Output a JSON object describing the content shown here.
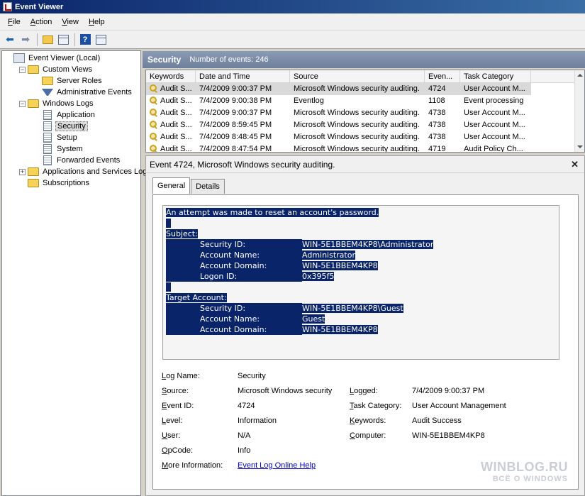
{
  "window": {
    "title": "Event Viewer"
  },
  "menu": [
    "File",
    "Action",
    "View",
    "Help"
  ],
  "tree": [
    {
      "label": "Event Viewer (Local)",
      "level": 0,
      "icon": "computer",
      "expander": ""
    },
    {
      "label": "Custom Views",
      "level": 1,
      "icon": "folder",
      "expander": "−"
    },
    {
      "label": "Server Roles",
      "level": 2,
      "icon": "folder",
      "expander": ""
    },
    {
      "label": "Administrative Events",
      "level": 2,
      "icon": "filter",
      "expander": ""
    },
    {
      "label": "Windows Logs",
      "level": 1,
      "icon": "folder",
      "expander": "−"
    },
    {
      "label": "Application",
      "level": 2,
      "icon": "log",
      "expander": ""
    },
    {
      "label": "Security",
      "level": 2,
      "icon": "log",
      "expander": "",
      "selected": true
    },
    {
      "label": "Setup",
      "level": 2,
      "icon": "log",
      "expander": ""
    },
    {
      "label": "System",
      "level": 2,
      "icon": "log",
      "expander": ""
    },
    {
      "label": "Forwarded Events",
      "level": 2,
      "icon": "log",
      "expander": ""
    },
    {
      "label": "Applications and Services Logs",
      "level": 1,
      "icon": "folder",
      "expander": "+"
    },
    {
      "label": "Subscriptions",
      "level": 1,
      "icon": "folder",
      "expander": ""
    }
  ],
  "pane": {
    "title": "Security",
    "count": "Number of events: 246"
  },
  "events": {
    "columns": [
      "Keywords",
      "Date and Time",
      "Source",
      "Even...",
      "Task Category"
    ],
    "rows": [
      {
        "keywords": "Audit S...",
        "date": "7/4/2009 9:00:37 PM",
        "source": "Microsoft Windows security auditing.",
        "id": "4724",
        "task": "User Account M...",
        "selected": true
      },
      {
        "keywords": "Audit S...",
        "date": "7/4/2009 9:00:38 PM",
        "source": "Eventlog",
        "id": "1108",
        "task": "Event processing"
      },
      {
        "keywords": "Audit S...",
        "date": "7/4/2009 9:00:37 PM",
        "source": "Microsoft Windows security auditing.",
        "id": "4738",
        "task": "User Account M..."
      },
      {
        "keywords": "Audit S...",
        "date": "7/4/2009 8:59:45 PM",
        "source": "Microsoft Windows security auditing.",
        "id": "4738",
        "task": "User Account M..."
      },
      {
        "keywords": "Audit S...",
        "date": "7/4/2009 8:48:45 PM",
        "source": "Microsoft Windows security auditing.",
        "id": "4738",
        "task": "User Account M..."
      },
      {
        "keywords": "Audit S...",
        "date": "7/4/2009 8:47:54 PM",
        "source": "Microsoft Windows security auditing.",
        "id": "4719",
        "task": "Audit Policy Ch..."
      }
    ]
  },
  "detail": {
    "header": "Event 4724, Microsoft Windows security auditing.",
    "tabs": [
      "General",
      "Details"
    ],
    "description": {
      "intro": "An attempt was made to reset an account's password.",
      "subject_label": "Subject:",
      "subject": [
        {
          "k": "Security ID:",
          "v": "WIN-5E1BBEM4KP8\\Administrator"
        },
        {
          "k": "Account Name:",
          "v": "Administrator"
        },
        {
          "k": "Account Domain:",
          "v": "WIN-5E1BBEM4KP8"
        },
        {
          "k": "Logon ID:",
          "v": "0x395f5"
        }
      ],
      "target_label": "Target Account:",
      "target": [
        {
          "k": "Security ID:",
          "v": "WIN-5E1BBEM4KP8\\Guest"
        },
        {
          "k": "Account Name:",
          "v": "Guest"
        },
        {
          "k": "Account Domain:",
          "v": "WIN-5E1BBEM4KP8"
        }
      ]
    },
    "props": {
      "log_name_label": "Log Name:",
      "log_name": "Security",
      "source_label": "Source:",
      "source": "Microsoft Windows security",
      "logged_label": "Logged:",
      "logged": "7/4/2009 9:00:37 PM",
      "event_id_label": "Event ID:",
      "event_id": "4724",
      "task_category_label": "Task Category:",
      "task_category": "User Account Management",
      "level_label": "Level:",
      "level": "Information",
      "keywords_label": "Keywords:",
      "keywords": "Audit Success",
      "user_label": "User:",
      "user": "N/A",
      "computer_label": "Computer:",
      "computer": "WIN-5E1BBEM4KP8",
      "opcode_label": "OpCode:",
      "opcode": "Info",
      "more_info_label": "More Information:",
      "more_info_link": "Event Log Online Help"
    }
  },
  "watermark": {
    "line1": "WINBLOG.RU",
    "line2": "ВСЁ О WINDOWS"
  }
}
